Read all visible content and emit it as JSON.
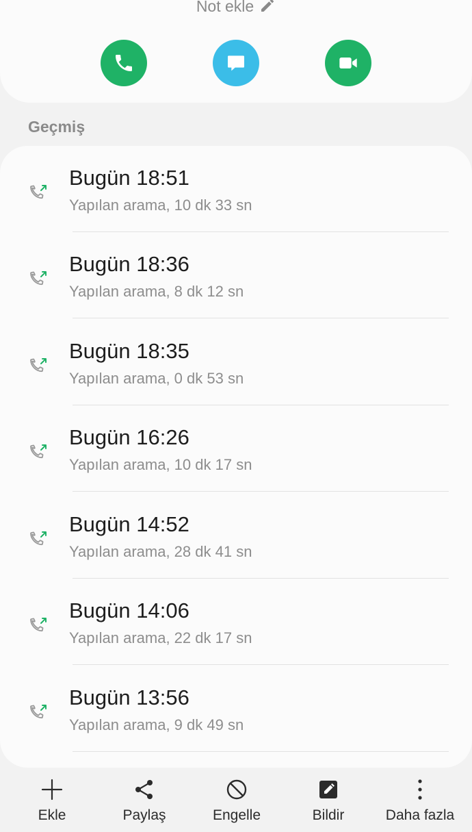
{
  "header": {
    "note_label": "Not ekle",
    "actions": [
      {
        "name": "call",
        "icon": "phone-icon",
        "color": "#1fb266"
      },
      {
        "name": "message",
        "icon": "message-icon",
        "color": "#3bbde8"
      },
      {
        "name": "video",
        "icon": "video-icon",
        "color": "#1fb266"
      }
    ]
  },
  "history": {
    "title": "Geçmiş",
    "items": [
      {
        "time": "Bugün 18:51",
        "detail": "Yapılan arama, 10 dk 33 sn"
      },
      {
        "time": "Bugün 18:36",
        "detail": "Yapılan arama, 8 dk 12 sn"
      },
      {
        "time": "Bugün 18:35",
        "detail": "Yapılan arama, 0 dk 53 sn"
      },
      {
        "time": "Bugün 16:26",
        "detail": "Yapılan arama, 10 dk 17 sn"
      },
      {
        "time": "Bugün 14:52",
        "detail": "Yapılan arama, 28 dk 41 sn"
      },
      {
        "time": "Bugün 14:06",
        "detail": "Yapılan arama, 22 dk 17 sn"
      },
      {
        "time": "Bugün 13:56",
        "detail": "Yapılan arama, 9 dk 49 sn"
      }
    ]
  },
  "bottom_bar": {
    "add": "Ekle",
    "share": "Paylaş",
    "block": "Engelle",
    "report": "Bildir",
    "more": "Daha fazla"
  },
  "colors": {
    "outgoing_arrow": "#1fb266",
    "handset": "#9a9a9a"
  }
}
